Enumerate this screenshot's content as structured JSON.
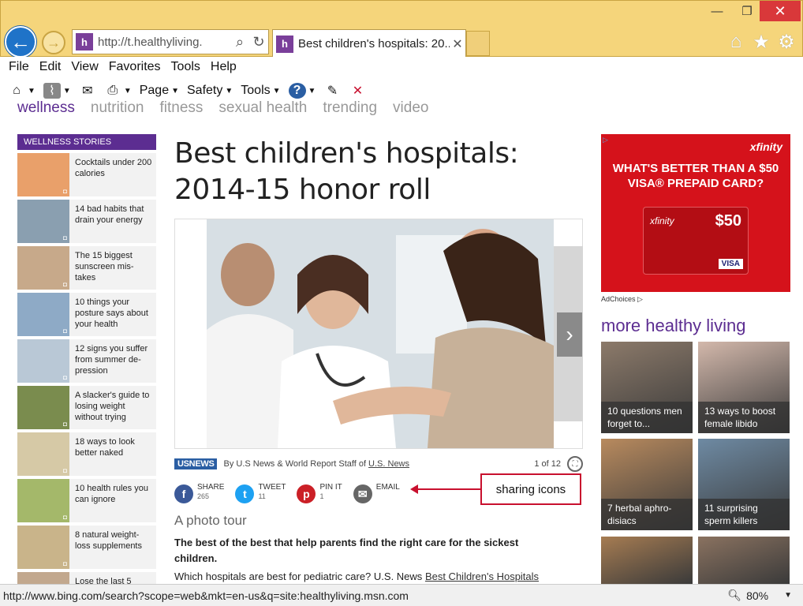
{
  "browser": {
    "address": "http://t.healthyliving.",
    "tab_title": "Best children's hospitals: 20...",
    "tab_close": "✕",
    "site_icon_letter": "h"
  },
  "window": {
    "minimize": "—",
    "restore": "❐",
    "close": "✕"
  },
  "menu": [
    "File",
    "Edit",
    "View",
    "Favorites",
    "Tools",
    "Help"
  ],
  "toolbar": {
    "page": "Page",
    "safety": "Safety",
    "tools": "Tools"
  },
  "topnav": [
    "wellness",
    "nutrition",
    "fitness",
    "sexual health",
    "trending",
    "video"
  ],
  "sidebar": {
    "heading": "WELLNESS STORIES",
    "stories": [
      {
        "title": "Cocktails under 200 calories",
        "color": "#e9a06a"
      },
      {
        "title": "14 bad habits that drain your energy",
        "color": "#8a9fb0"
      },
      {
        "title": "The 15 biggest sunscreen mis-takes",
        "color": "#c7a98a"
      },
      {
        "title": "10 things your posture says about your health",
        "color": "#8eaac6"
      },
      {
        "title": "12 signs you suffer from summer de-pression",
        "color": "#b9c8d6"
      },
      {
        "title": "A slacker's guide to losing weight without trying",
        "color": "#7a8c4e"
      },
      {
        "title": "18 ways to look better naked",
        "color": "#d6c9a6"
      },
      {
        "title": "10 health rules you can ignore",
        "color": "#a4b86a"
      },
      {
        "title": "8 natural weight-loss supplements",
        "color": "#c9b48a"
      },
      {
        "title": "Lose the last 5",
        "color": "#c2a88e"
      }
    ]
  },
  "article": {
    "headline": "Best children's hospitals: 2014-15 honor roll",
    "source_logo": "USNEWS",
    "byline": "By U.S News & World Report Staff of",
    "byline_link": "U.S. News",
    "pager": "1 of 12",
    "next": "›",
    "subhead": "A photo tour",
    "lead": "The best of the best that help parents find the right care for the sickest children.",
    "body_prefix": "Which hospitals are best for pediatric care? U.S. News",
    "body_link": "Best Children's Hospitals"
  },
  "share": [
    {
      "label": "SHARE",
      "count": "265",
      "glyph": "f",
      "color": "#3b5998"
    },
    {
      "label": "TWEET",
      "count": "11",
      "glyph": "t",
      "color": "#1da1f2"
    },
    {
      "label": "PIN IT",
      "count": "1",
      "glyph": "p",
      "color": "#cb2027"
    },
    {
      "label": "EMAIL",
      "count": "",
      "glyph": "✉",
      "color": "#666666"
    }
  ],
  "callout": "sharing icons",
  "ad": {
    "brand": "xfinity",
    "headline": "WHAT'S BETTER THAN A $50 VISA® PREPAID CARD?",
    "card_brand": "xfinity",
    "card_amount": "$50",
    "card_network": "VISA",
    "adchoices": "AdChoices ▷"
  },
  "more": {
    "title": "more healthy living",
    "tiles": [
      {
        "caption": "10 questions men forget to...",
        "color": "#8c7a6a"
      },
      {
        "caption": "13 ways to boost female libido",
        "color": "#d3b8ab"
      },
      {
        "caption": "7 herbal aphro-disiacs",
        "color": "#b88a5e"
      },
      {
        "caption": "11 surprising sperm killers",
        "color": "#6e8aa3"
      },
      {
        "caption": "",
        "color": "#a67c52"
      },
      {
        "caption": "",
        "color": "#8a7260"
      }
    ]
  },
  "status": {
    "url": "http://www.bing.com/search?scope=web&mkt=en-us&q=site:healthyliving.msn.com",
    "zoom": "80%"
  }
}
